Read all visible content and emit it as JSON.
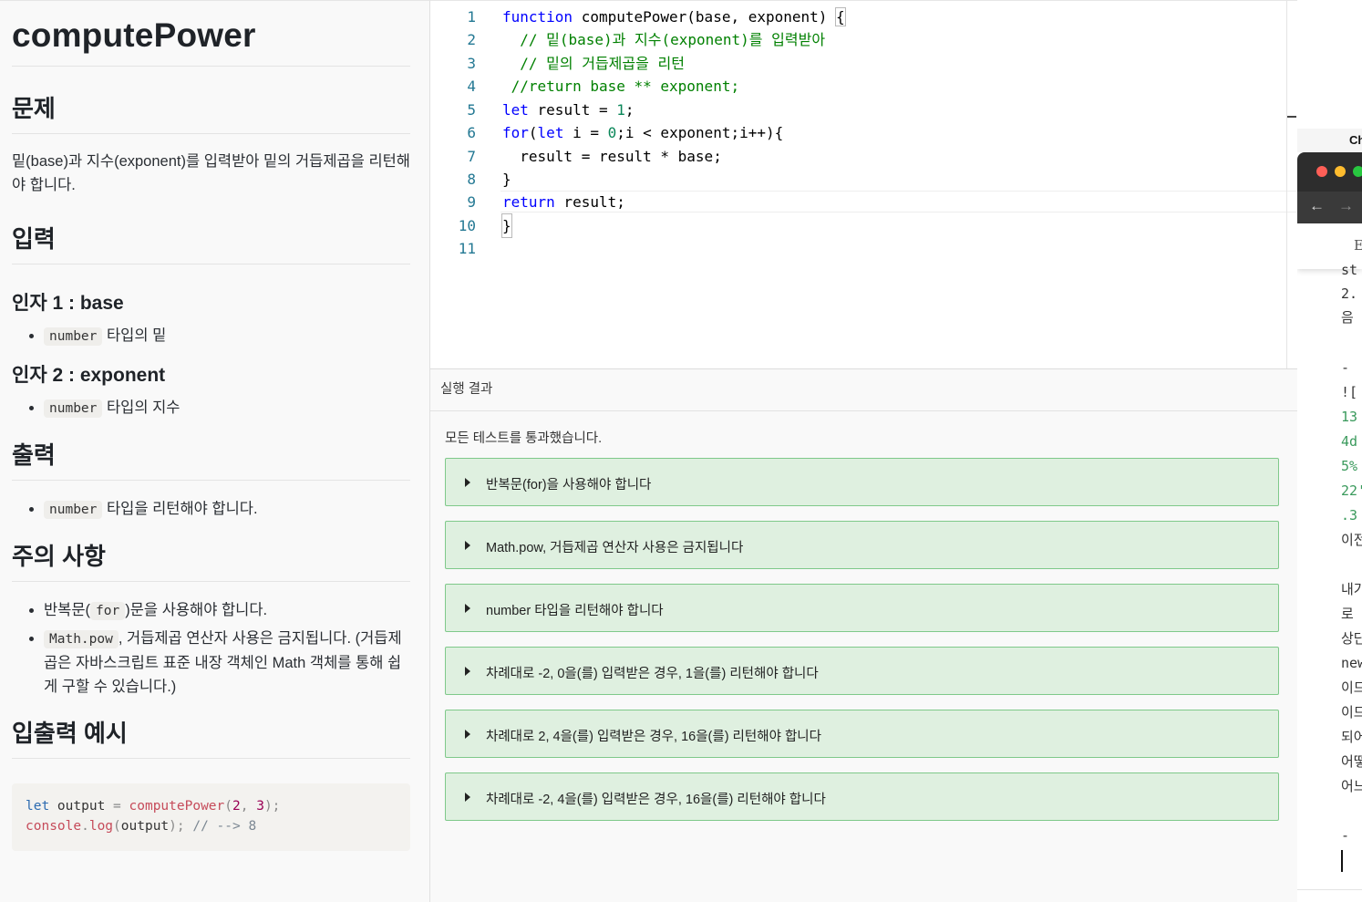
{
  "problem": {
    "title": "computePower",
    "section_problem": "문제",
    "problem_text": "밑(base)과 지수(exponent)를 입력받아 밑의 거듭제곱을 리턴해야 합니다.",
    "section_input": "입력",
    "arg1_heading": "인자 1 : base",
    "arg1_type": "number",
    "arg1_desc": "타입의 밑",
    "arg2_heading": "인자 2 : exponent",
    "arg2_type": "number",
    "arg2_desc": "타입의 지수",
    "section_output": "출력",
    "output_type": "number",
    "output_desc": "타입을 리턴해야 합니다.",
    "section_notes": "주의 사항",
    "note1_pre": "반복문(",
    "note1_code": "for",
    "note1_post": ")문을 사용해야 합니다.",
    "note2_code": "Math.pow",
    "note2_text": ", 거듭제곱 연산자 사용은 금지됩니다. (거듭제곱은 자바스크립트 표준 내장 객체인 Math 객체를 통해 쉽게 구할 수 있습니다.)",
    "section_example": "입출력 예시",
    "example": {
      "l1_kw": "let",
      "l1_var": " output ",
      "l1_eq": "=",
      "l1_fn": " computePower",
      "l1_p1": "(",
      "l1_n1": "2",
      "l1_c": ", ",
      "l1_n2": "3",
      "l1_p2": ");",
      "l2_obj": "console",
      "l2_dot": ".",
      "l2_fn": "log",
      "l2_p1": "(",
      "l2_var": "output",
      "l2_p2": ");",
      "l2_cm": " // --> 8"
    }
  },
  "editor": {
    "line_numbers": [
      "1",
      "2",
      "3",
      "4",
      "5",
      "6",
      "7",
      "8",
      "9",
      "10",
      "11"
    ],
    "l1_kw": "function",
    "l1_sig": " computePower(base, exponent) ",
    "l1_brace": "{",
    "l2": "  // 밑(base)과 지수(exponent)를 입력받아",
    "l3": "  // 밑의 거듭제곱을 리턴",
    "l4": " //return base ** exponent;",
    "l5_kw": "let",
    "l5_mid": " result = ",
    "l5_num": "1",
    "l5_end": ";",
    "l6_kw1": "for",
    "l6_a": "(",
    "l6_kw2": "let",
    "l6_b": " i = ",
    "l6_num": "0",
    "l6_c": ";i < exponent;i++){",
    "l7": "  result = result * base;",
    "l8": "}",
    "l9_kw": "return",
    "l9_rest": " result;",
    "l10": "}",
    "l11": ""
  },
  "results": {
    "header": "실행 결과",
    "summary": "모든 테스트를 통과했습니다.",
    "tests": [
      "반복문(for)을 사용해야 합니다",
      "Math.pow, 거듭제곱 연산자 사용은 금지됩니다",
      "number 타입을 리턴해야 합니다",
      "차례대로 -2, 0을(를) 입력받은 경우, 1을(를) 리턴해야 합니다",
      "차례대로 2, 4을(를) 입력받은 경우, 16을(를) 리턴해야 합니다",
      "차례대로 -2, 4을(를) 입력받은 경우, 16을(를) 리턴해야 합니다"
    ],
    "status_color": "#dff0e0"
  },
  "side_window": {
    "apple_glyph": "",
    "menubar_app": "Ch",
    "back_arrow": "←",
    "forward_arrow": "→",
    "page_glyph": "E",
    "lines": [
      "st",
      "2.",
      "음",
      "",
      "- ",
      "![",
      "13",
      "4d",
      "5%",
      "22'",
      ".3",
      "이전",
      "",
      "내가",
      "로 ",
      "상단",
      "new",
      "이므",
      "이므",
      "되어",
      "어떻",
      "어느",
      "",
      "- "
    ],
    "window_controls": [
      "#ff5f57",
      "#febc2e",
      "#28c840"
    ]
  }
}
